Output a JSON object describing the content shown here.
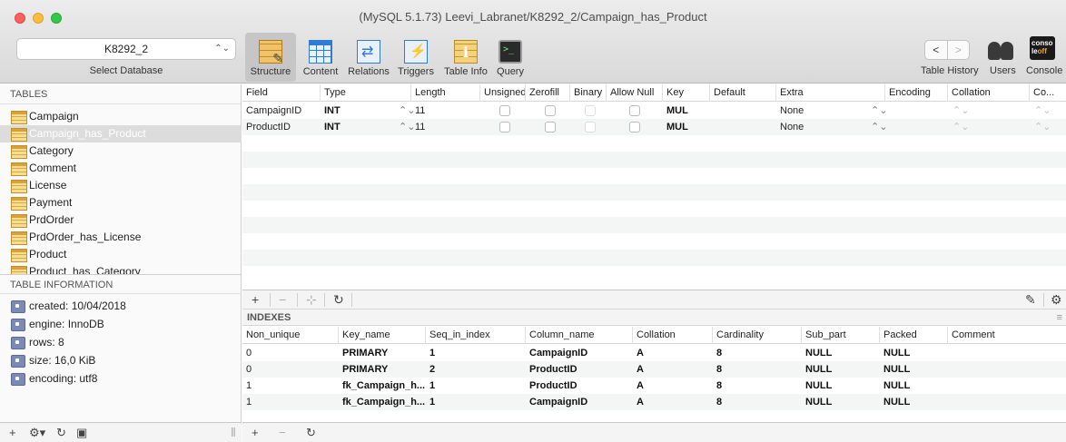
{
  "window": {
    "title": "(MySQL 5.1.73) Leevi_Labranet/K8292_2/Campaign_has_Product"
  },
  "database": {
    "selected": "K8292_2",
    "label": "Select Database"
  },
  "toolbar": {
    "tabs": [
      {
        "label": "Structure",
        "icon": "structure-icon"
      },
      {
        "label": "Content",
        "icon": "content-icon"
      },
      {
        "label": "Relations",
        "icon": "relations-icon"
      },
      {
        "label": "Triggers",
        "icon": "triggers-icon"
      },
      {
        "label": "Table Info",
        "icon": "table-info-icon"
      },
      {
        "label": "Query",
        "icon": "query-icon"
      }
    ],
    "active_tab": "Structure",
    "table_history_label": "Table History",
    "users_label": "Users",
    "console_label": "Console",
    "console_icon_top": "conso",
    "console_icon_bottom": "le",
    "console_icon_off": "off"
  },
  "sidebar": {
    "tables_header": "TABLES",
    "tables": [
      "Campaign",
      "Campaign_has_Product",
      "Category",
      "Comment",
      "License",
      "Payment",
      "PrdOrder",
      "PrdOrder_has_License",
      "Product",
      "Product_has_Category"
    ],
    "selected_table": "Campaign_has_Product",
    "info_header": "TABLE INFORMATION",
    "info": [
      "created: 10/04/2018",
      "engine: InnoDB",
      "rows: 8",
      "size: 16,0 KiB",
      "encoding: utf8"
    ]
  },
  "structure": {
    "columns": [
      "Field",
      "Type",
      "Length",
      "Unsigned",
      "Zerofill",
      "Binary",
      "Allow Null",
      "Key",
      "Default",
      "Extra",
      "Encoding",
      "Collation",
      "Co..."
    ],
    "rows": [
      {
        "field": "CampaignID",
        "type": "INT",
        "length": "11",
        "key": "MUL",
        "extra": "None"
      },
      {
        "field": "ProductID",
        "type": "INT",
        "length": "11",
        "key": "MUL",
        "extra": "None"
      }
    ]
  },
  "indexes": {
    "label": "INDEXES",
    "columns": [
      "Non_unique",
      "Key_name",
      "Seq_in_index",
      "Column_name",
      "Collation",
      "Cardinality",
      "Sub_part",
      "Packed",
      "Comment"
    ],
    "rows": [
      [
        "0",
        "PRIMARY",
        "1",
        "CampaignID",
        "A",
        "8",
        "NULL",
        "NULL",
        ""
      ],
      [
        "0",
        "PRIMARY",
        "2",
        "ProductID",
        "A",
        "8",
        "NULL",
        "NULL",
        ""
      ],
      [
        "1",
        "fk_Campaign_h...",
        "1",
        "ProductID",
        "A",
        "8",
        "NULL",
        "NULL",
        ""
      ],
      [
        "1",
        "fk_Campaign_h...",
        "1",
        "CampaignID",
        "A",
        "8",
        "NULL",
        "NULL",
        ""
      ]
    ]
  },
  "colors": {
    "selection": "#dcdcdc",
    "accent": "#2f7bd6",
    "row_alt": "#f4f5f5"
  }
}
